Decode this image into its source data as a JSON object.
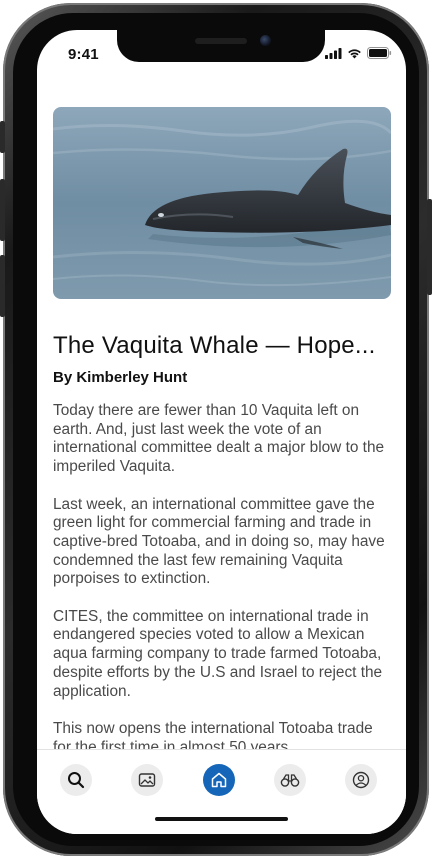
{
  "status_bar": {
    "time": "9:41",
    "icons": [
      "cellular-signal-icon",
      "wifi-icon",
      "battery-icon"
    ]
  },
  "article": {
    "image_alt": "Vaquita porpoise swimming at water surface",
    "title": "The Vaquita Whale — Hope...",
    "author": "By Kimberley Hunt",
    "paragraphs": [
      "Today there are fewer than 10 Vaquita left on earth. And, just last week the vote of an international committee dealt a major blow to the imperiled Vaquita.",
      "Last week, an international committee gave the green light for commercial farming and trade in captive-bred Totoaba, and in doing so, may have condemned the last few remaining Vaquita porpoises to extinction.",
      "CITES, the committee on international trade in endangered species voted to allow a Mexican aqua farming company to trade farmed Totoaba, despite efforts by the U.S and Israel to reject the application.",
      "This now opens the international Totoaba trade for the first time in almost 50 years."
    ]
  },
  "tabbar": {
    "items": [
      {
        "icon": "search-icon",
        "active": false
      },
      {
        "icon": "gallery-icon",
        "active": false
      },
      {
        "icon": "home-icon",
        "active": true
      },
      {
        "icon": "binoculars-icon",
        "active": false
      },
      {
        "icon": "profile-icon",
        "active": false
      }
    ]
  },
  "colors": {
    "accent": "#1566b8",
    "title_text": "#111111",
    "body_text": "#4a4a4a",
    "tab_inactive_bg": "#ececec"
  }
}
